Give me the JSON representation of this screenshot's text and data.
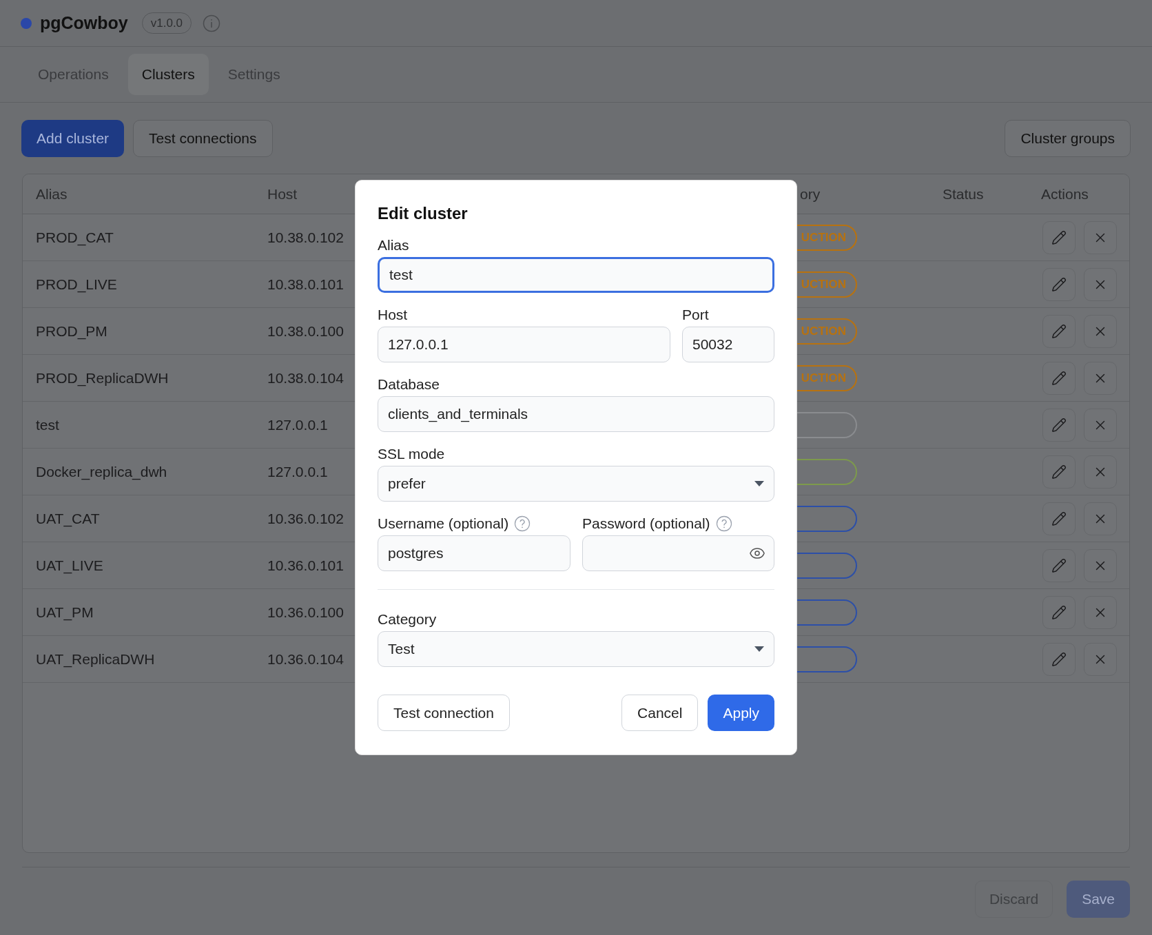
{
  "app": {
    "name": "pgCowboy",
    "version": "v1.0.0"
  },
  "tabs": [
    {
      "label": "Operations",
      "selected": false
    },
    {
      "label": "Clusters",
      "selected": true
    },
    {
      "label": "Settings",
      "selected": false
    }
  ],
  "toolbar": {
    "add_button": "Add cluster",
    "test_button": "Test connections",
    "groups_button": "Cluster groups"
  },
  "table": {
    "columns": [
      "Alias",
      "Host",
      "ory",
      "Status",
      "Actions"
    ],
    "rows": [
      {
        "alias": "PROD_CAT",
        "host": "10.38.0.102",
        "category": {
          "text": "UCTION",
          "color": "#b8720f"
        }
      },
      {
        "alias": "PROD_LIVE",
        "host": "10.38.0.101",
        "category": {
          "text": "UCTION",
          "color": "#b8720f"
        }
      },
      {
        "alias": "PROD_PM",
        "host": "10.38.0.100",
        "category": {
          "text": "UCTION",
          "color": "#b8720f"
        }
      },
      {
        "alias": "PROD_ReplicaDWH",
        "host": "10.38.0.104",
        "category": {
          "text": "UCTION",
          "color": "#b8720f"
        }
      },
      {
        "alias": "test",
        "host": "127.0.0.1",
        "category": {
          "color": "#8a8c8f"
        }
      },
      {
        "alias": "Docker_replica_dwh",
        "host": "127.0.0.1",
        "category": {
          "color": "#7d9a4c"
        }
      },
      {
        "alias": "UAT_CAT",
        "host": "10.36.0.102",
        "category": {
          "color": "#2c4fa8"
        }
      },
      {
        "alias": "UAT_LIVE",
        "host": "10.36.0.101",
        "category": {
          "color": "#2c4fa8"
        }
      },
      {
        "alias": "UAT_PM",
        "host": "10.36.0.100",
        "category": {
          "color": "#2c4fa8"
        }
      },
      {
        "alias": "UAT_ReplicaDWH",
        "host": "10.36.0.104",
        "category": {
          "color": "#2c4fa8"
        }
      }
    ]
  },
  "footer": {
    "discard_button": "Discard",
    "save_button": "Save"
  },
  "dialog": {
    "title": "Edit cluster",
    "alias": {
      "label": "Alias",
      "value": "test",
      "focused": true
    },
    "host": {
      "label": "Host",
      "value": "127.0.0.1",
      "focused": false
    },
    "port": {
      "label": "Port",
      "value": "50032",
      "focused": false
    },
    "database": {
      "label": "Database",
      "value": "clients_and_terminals",
      "focused": false
    },
    "ssl_mode": {
      "label": "SSL mode",
      "value": "prefer"
    },
    "username": {
      "label": "Username (optional)",
      "value": "postgres",
      "focused": false
    },
    "password": {
      "label": "Password (optional)"
    },
    "category": {
      "label": "Category",
      "value": "Test"
    },
    "test_button": "Test connection",
    "cancel_button": "Cancel",
    "apply_button": "Apply"
  }
}
